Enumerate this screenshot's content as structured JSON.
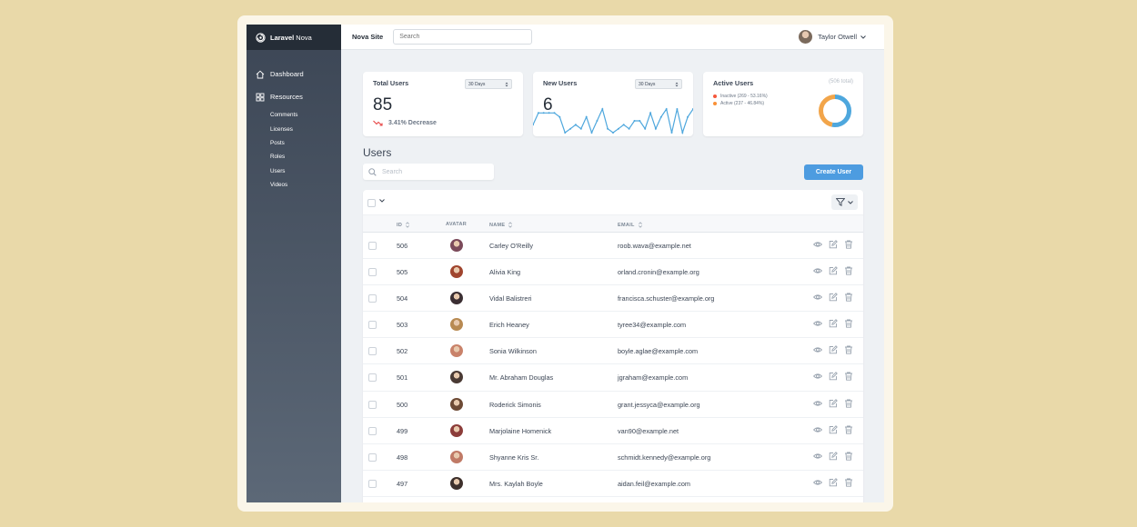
{
  "brand": {
    "name_bold": "Laravel",
    "name_rest": "Nova"
  },
  "sidebar": {
    "dashboard": "Dashboard",
    "resources": "Resources",
    "items": [
      "Comments",
      "Licenses",
      "Posts",
      "Roles",
      "Users",
      "Videos"
    ]
  },
  "header": {
    "site": "Nova Site",
    "search_placeholder": "Search",
    "user_name": "Taylor Otwell"
  },
  "metrics": {
    "total_users": {
      "title": "Total Users",
      "range": "30 Days",
      "value": "85",
      "trend": "3.41% Decrease"
    },
    "new_users": {
      "title": "New Users",
      "range": "30 Days",
      "value": "6",
      "series": [
        2,
        5,
        5,
        5,
        5,
        4,
        0,
        1,
        2,
        1,
        4,
        0,
        3,
        6,
        1,
        0,
        1,
        2,
        1,
        3,
        3,
        1,
        5,
        1,
        4,
        6,
        0,
        6,
        0,
        4,
        6
      ]
    },
    "active_users": {
      "title": "Active Users",
      "total": "(506 total)",
      "legend": [
        "Inactive (269 - 53.16%)",
        "Active (237 - 46.84%)"
      ],
      "shares": [
        53.16,
        46.84
      ],
      "colors": [
        "#f5573b",
        "#f99037"
      ],
      "donut_colors": [
        "#4ea7dd",
        "#f2a54a"
      ]
    }
  },
  "users": {
    "title": "Users",
    "search_placeholder": "Search",
    "create_label": "Create User",
    "columns": {
      "id": "ID",
      "avatar": "AVATAR",
      "name": "NAME",
      "email": "EMAIL"
    },
    "rows": [
      {
        "id": "506",
        "name": "Carley O'Reilly",
        "email": "roob.wava@example.net",
        "avatar_color": "#7b4a5a"
      },
      {
        "id": "505",
        "name": "Alivia King",
        "email": "orland.cronin@example.org",
        "avatar_color": "#a0452e"
      },
      {
        "id": "504",
        "name": "Vidal Balistreri",
        "email": "francisca.schuster@example.org",
        "avatar_color": "#3b2f33"
      },
      {
        "id": "503",
        "name": "Erich Heaney",
        "email": "tyree34@example.com",
        "avatar_color": "#b88a52"
      },
      {
        "id": "502",
        "name": "Sonia Wilkinson",
        "email": "boyle.aglae@example.com",
        "avatar_color": "#c9826a"
      },
      {
        "id": "501",
        "name": "Mr. Abraham Douglas",
        "email": "jgraham@example.com",
        "avatar_color": "#4a3a34"
      },
      {
        "id": "500",
        "name": "Roderick Simonis",
        "email": "grant.jessyca@example.org",
        "avatar_color": "#6d4a35"
      },
      {
        "id": "499",
        "name": "Marjolaine Homenick",
        "email": "van90@example.net",
        "avatar_color": "#8c3d3a"
      },
      {
        "id": "498",
        "name": "Shyanne Kris Sr.",
        "email": "schmidt.kennedy@example.org",
        "avatar_color": "#c07a66"
      },
      {
        "id": "497",
        "name": "Mrs. Kaylah Boyle",
        "email": "aidan.feil@example.com",
        "avatar_color": "#3e302c"
      }
    ]
  }
}
